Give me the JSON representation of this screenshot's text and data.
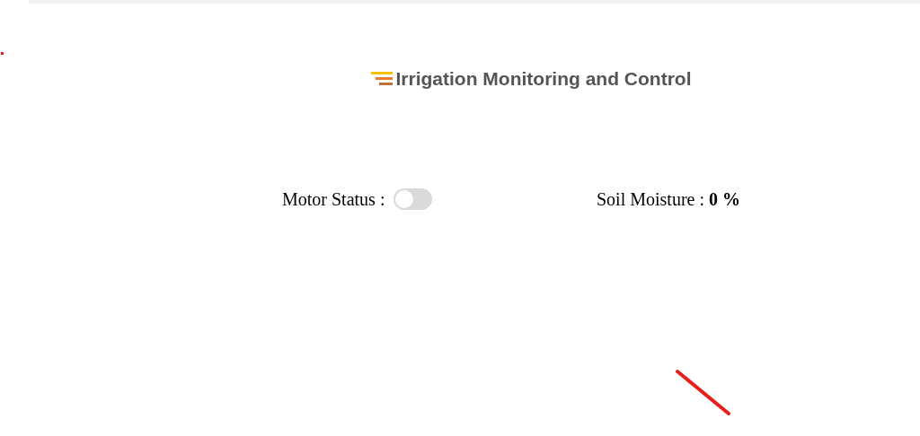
{
  "header": {
    "title": "Irrigation Monitoring and Control"
  },
  "motor": {
    "label": "Motor Status :",
    "on": false
  },
  "soil_moisture": {
    "label": "Soil Moisture :",
    "value": "0 %"
  }
}
